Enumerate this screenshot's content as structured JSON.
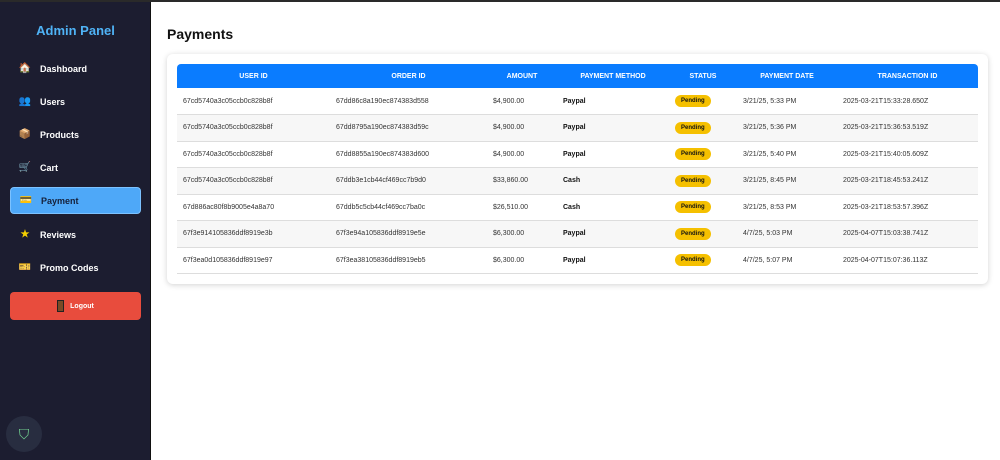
{
  "sidebar": {
    "brand": "Admin Panel",
    "items": [
      {
        "label": "Dashboard",
        "icon": "house-icon",
        "glyph": "🏠"
      },
      {
        "label": "Users",
        "icon": "users-icon",
        "glyph": "👥"
      },
      {
        "label": "Products",
        "icon": "box-icon",
        "glyph": "📦"
      },
      {
        "label": "Cart",
        "icon": "cart-icon",
        "glyph": "🛒"
      },
      {
        "label": "Payment",
        "icon": "credit-card-icon",
        "glyph": "💳"
      },
      {
        "label": "Reviews",
        "icon": "star-icon",
        "glyph": "★"
      },
      {
        "label": "Promo Codes",
        "icon": "ticket-icon",
        "glyph": "🎫"
      }
    ],
    "active": "Payment",
    "logout": "Logout"
  },
  "page": {
    "title": "Payments"
  },
  "table": {
    "headers": [
      "USER ID",
      "ORDER ID",
      "AMOUNT",
      "PAYMENT METHOD",
      "STATUS",
      "PAYMENT DATE",
      "TRANSACTION ID"
    ],
    "rows": [
      [
        "67cd5740a3c05ccb0c828b8f",
        "67dd86c8a190ec874383d558",
        "$4,900.00",
        "Paypal",
        "Pending",
        "3/21/25, 5:33 PM",
        "2025-03-21T15:33:28.650Z"
      ],
      [
        "67cd5740a3c05ccb0c828b8f",
        "67dd8795a190ec874383d59c",
        "$4,900.00",
        "Paypal",
        "Pending",
        "3/21/25, 5:36 PM",
        "2025-03-21T15:36:53.519Z"
      ],
      [
        "67cd5740a3c05ccb0c828b8f",
        "67dd8855a190ec874383d600",
        "$4,900.00",
        "Paypal",
        "Pending",
        "3/21/25, 5:40 PM",
        "2025-03-21T15:40:05.609Z"
      ],
      [
        "67cd5740a3c05ccb0c828b8f",
        "67ddb3e1cb44cf469cc7b9d0",
        "$33,860.00",
        "Cash",
        "Pending",
        "3/21/25, 8:45 PM",
        "2025-03-21T18:45:53.241Z"
      ],
      [
        "67d886ac80f8b9005e4a8a70",
        "67ddb5c5cb44cf469cc7ba0c",
        "$26,510.00",
        "Cash",
        "Pending",
        "3/21/25, 8:53 PM",
        "2025-03-21T18:53:57.396Z"
      ],
      [
        "67f3e914105836ddf8919e3b",
        "67f3e94a105836ddf8919e5e",
        "$6,300.00",
        "Paypal",
        "Pending",
        "4/7/25, 5:03 PM",
        "2025-04-07T15:03:38.741Z"
      ],
      [
        "67f3ea0d105836ddf8919e97",
        "67f3ea38105836ddf8919eb5",
        "$6,300.00",
        "Paypal",
        "Pending",
        "4/7/25, 5:07 PM",
        "2025-04-07T15:07:36.113Z"
      ]
    ]
  },
  "colors": {
    "accent": "#0a7cff",
    "sidebar": "#1c1d30",
    "active": "#4ea8f8",
    "logout": "#e84c3d",
    "badge": "#f5c000"
  }
}
